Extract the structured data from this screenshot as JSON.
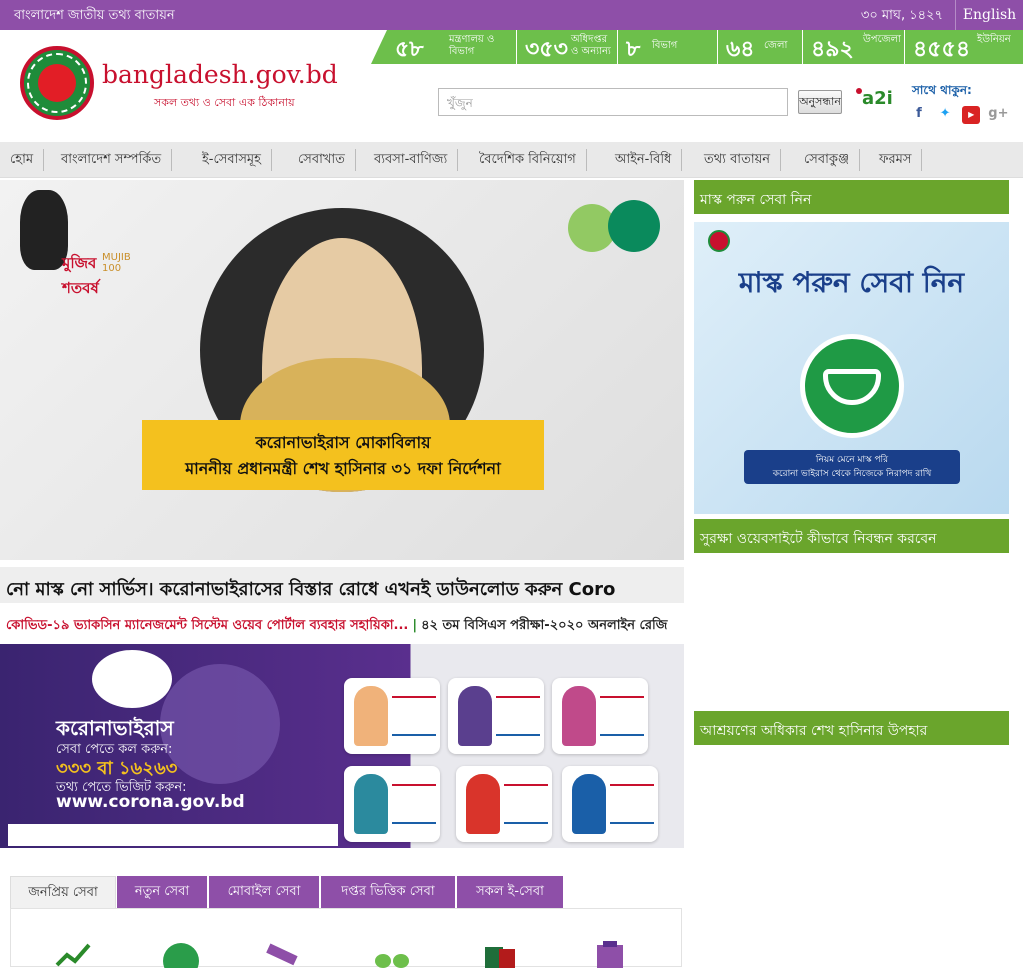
{
  "topbar": {
    "portal": "বাংলাদেশ জাতীয় তথ্য বাতায়ন",
    "date": "৩০ মাঘ, ১৪২৭",
    "language": "English"
  },
  "brand": {
    "name": "bangladesh.gov.bd",
    "tagline": "সকল তথ্য ও সেবা এক ঠিকানায়"
  },
  "stats": [
    {
      "num": "৫৮",
      "label": "মন্ত্রণালয় ও বিভাগ"
    },
    {
      "num": "৩৫৩",
      "label": "অধিদপ্তর ও অন্যান্য"
    },
    {
      "num": "৮",
      "label": "বিভাগ"
    },
    {
      "num": "৬৪",
      "label": "জেলা"
    },
    {
      "num": "৪৯২",
      "label": "উপজেলা"
    },
    {
      "num": "৪৫৫৪",
      "label": "ইউনিয়ন"
    }
  ],
  "search": {
    "placeholder": "খুঁজুন",
    "button": "অনুসন্ধান"
  },
  "a2i": "a2i",
  "social": {
    "title": "সাথে থাকুন:",
    "icons": [
      "facebook-icon",
      "twitter-icon",
      "youtube-icon",
      "google-plus-icon"
    ]
  },
  "nav": [
    "হোম",
    "বাংলাদেশ সম্পর্কিত",
    "ই-সেবাসমূহ",
    "সেবাখাত",
    "ব্যবসা-বাণিজ্য",
    "বৈদেশিক বিনিয়োগ",
    "আইন-বিধি",
    "তথ্য বাতায়ন",
    "সেবাকুঞ্জ",
    "ফরমস"
  ],
  "hero": {
    "mujib_logo": "মুজিব শতবর্ষ",
    "mujib_en": "MUJIB 100",
    "banner_line1": "করোনাভাইরাস মোকাবিলায়",
    "banner_line2": "মাননীয় প্রধানমন্ত্রী শেখ হাসিনার ৩১ দফা নির্দেশনা"
  },
  "marquee": "নো মাস্ক নো সার্ভিস। করোনাভাইরাসের বিস্তার রোধে এখনই ডাউনলোড করুন Coro",
  "news": {
    "item1": "কোভিড-১৯ ভ্যাকসিন ম্যানেজমেন্ট সিস্টেম ওয়েব পোর্টাল ব্যবহার সহায়িকা...",
    "separator": "|",
    "item2": "৪২ তম বিসিএস পরীক্ষা-২০২০ অনলাইন রেজি"
  },
  "corona": {
    "heading": "করোনাভাইরাস",
    "call": "সেবা পেতে কল করুন:",
    "numbers": "৩৩৩ বা ১৬২৬৩",
    "visit": "তথ্য পেতে ভিজিট করুন:",
    "url": "www.corona.gov.bd"
  },
  "tabs": [
    "জনপ্রিয় সেবা",
    "নতুন সেবা",
    "মোবাইল সেবা",
    "দপ্তর ভিত্তিক সেবা",
    "সকল ই-সেবা"
  ],
  "service_icons": [
    "chart-icon",
    "globe-icon",
    "pen-icon",
    "footprint-icon",
    "passport-icon",
    "clipboard-icon"
  ],
  "sidebar": {
    "block1_title": "মাস্ক পরুন সেবা নিন",
    "mask_title": "মাস্ক পরুন সেবা নিন",
    "mask_line1": "নিয়ম মেনে মাস্ক পরি",
    "mask_line2": "করোনা ভাইরাস থেকে নিজেকে নিরাপদ রাখি",
    "block2_title": "সুরক্ষা ওয়েবসাইটে কীভাবে নিবন্ধন করবেন",
    "block3_title": "আশ্রয়ণের অধিকার শেখ হাসিনার উপহার"
  },
  "colors": {
    "topbar": "#8e4fa8",
    "stats": "#6dbf4b",
    "sidebar_header": "#6aa52c",
    "brand": "#c8102e"
  }
}
